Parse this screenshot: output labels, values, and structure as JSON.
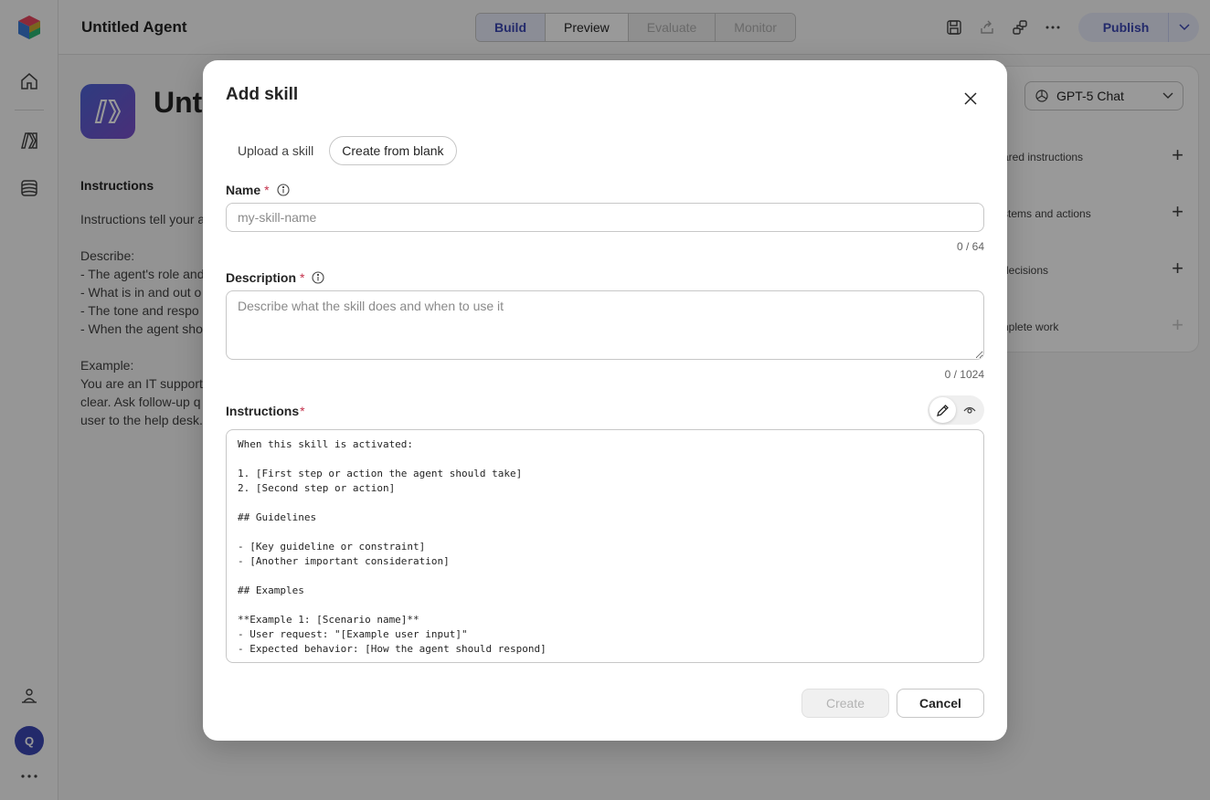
{
  "app": {
    "agent_title": "Untitled Agent",
    "agent_name_large": "Unti",
    "user_initial": "Q"
  },
  "mode_tabs": [
    {
      "label": "Build",
      "state": "active"
    },
    {
      "label": "Preview",
      "state": "normal"
    },
    {
      "label": "Evaluate",
      "state": "disabled"
    },
    {
      "label": "Monitor",
      "state": "disabled"
    }
  ],
  "publish": {
    "label": "Publish"
  },
  "background": {
    "instructions_heading": "Instructions",
    "instructions_text": "Instructions tell your a\n\nDescribe:\n- The agent's role and\n- What is in and out o\n- The tone and respo\n- When the agent sho\n\nExample:\nYou are an IT support\nclear. Ask follow-up q\nuser to the help desk."
  },
  "right_panel": {
    "model": "GPT-5 Chat",
    "rows": [
      {
        "label": "ared instructions"
      },
      {
        "label": "stems and actions"
      },
      {
        "label": "decisions"
      },
      {
        "label": "nplete work"
      }
    ]
  },
  "dialog": {
    "title": "Add skill",
    "tabs": [
      {
        "label": "Upload a skill",
        "active": false
      },
      {
        "label": "Create from blank",
        "active": true
      }
    ],
    "name": {
      "label": "Name",
      "required_mark": "*",
      "placeholder": "my-skill-name",
      "value": "",
      "counter": "0 / 64"
    },
    "description": {
      "label": "Description",
      "required_mark": "*",
      "placeholder": "Describe what the skill does and when to use it",
      "value": "",
      "counter": "0 / 1024"
    },
    "instructions": {
      "label": "Instructions",
      "required_mark": "*",
      "value": "When this skill is activated:\n\n1. [First step or action the agent should take]\n2. [Second step or action]\n\n## Guidelines\n\n- [Key guideline or constraint]\n- [Another important consideration]\n\n## Examples\n\n**Example 1: [Scenario name]**\n- User request: \"[Example user input]\"\n- Expected behavior: [How the agent should respond]"
    },
    "create_label": "Create",
    "cancel_label": "Cancel"
  },
  "colors": {
    "accent": "#3b46b3",
    "required": "#c4314b",
    "overlay": "rgba(0,0,0,0.4)"
  }
}
